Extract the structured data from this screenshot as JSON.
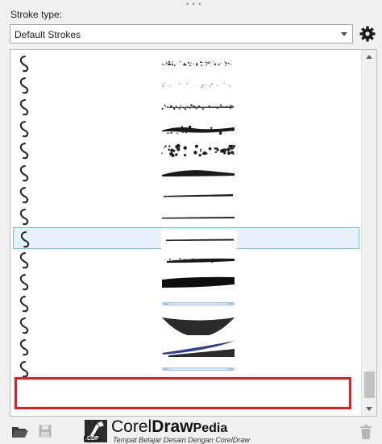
{
  "panel": {
    "stroke_type_label": "Stroke type:",
    "dropdown_value": "Default Strokes",
    "gear_icon": "gear-icon"
  },
  "strokes": [
    {
      "preview": "speckled"
    },
    {
      "preview": "faint-dots"
    },
    {
      "preview": "dry-brush"
    },
    {
      "preview": "splatter-heavy"
    },
    {
      "preview": "dots-cluster"
    },
    {
      "preview": "rough-wide"
    },
    {
      "preview": "thin-taper"
    },
    {
      "preview": "thin-line"
    },
    {
      "preview": "line-selected",
      "selected": true
    },
    {
      "preview": "ink-rough"
    },
    {
      "preview": "thick-brush"
    },
    {
      "preview": "blue-soft"
    },
    {
      "preview": "crescent-dark"
    },
    {
      "preview": "swoosh-blue"
    },
    {
      "preview": "blue-soft-2",
      "highlighted": true
    }
  ],
  "colors": {
    "selection_fill": "#e6f1fb",
    "selection_border": "#6ec0ef",
    "highlight_border": "#e01e24"
  },
  "bottom_bar": {
    "open_icon": "folder-icon",
    "save_icon": "save-icon",
    "delete_icon": "trash-icon"
  },
  "watermark": {
    "brand_regular": "Corel",
    "brand_bold": "Draw",
    "brand_suffix": "Pedia",
    "tagline": "Tempat Belajar Desain Dengan CorelDraw",
    "badge": ".CDP"
  }
}
